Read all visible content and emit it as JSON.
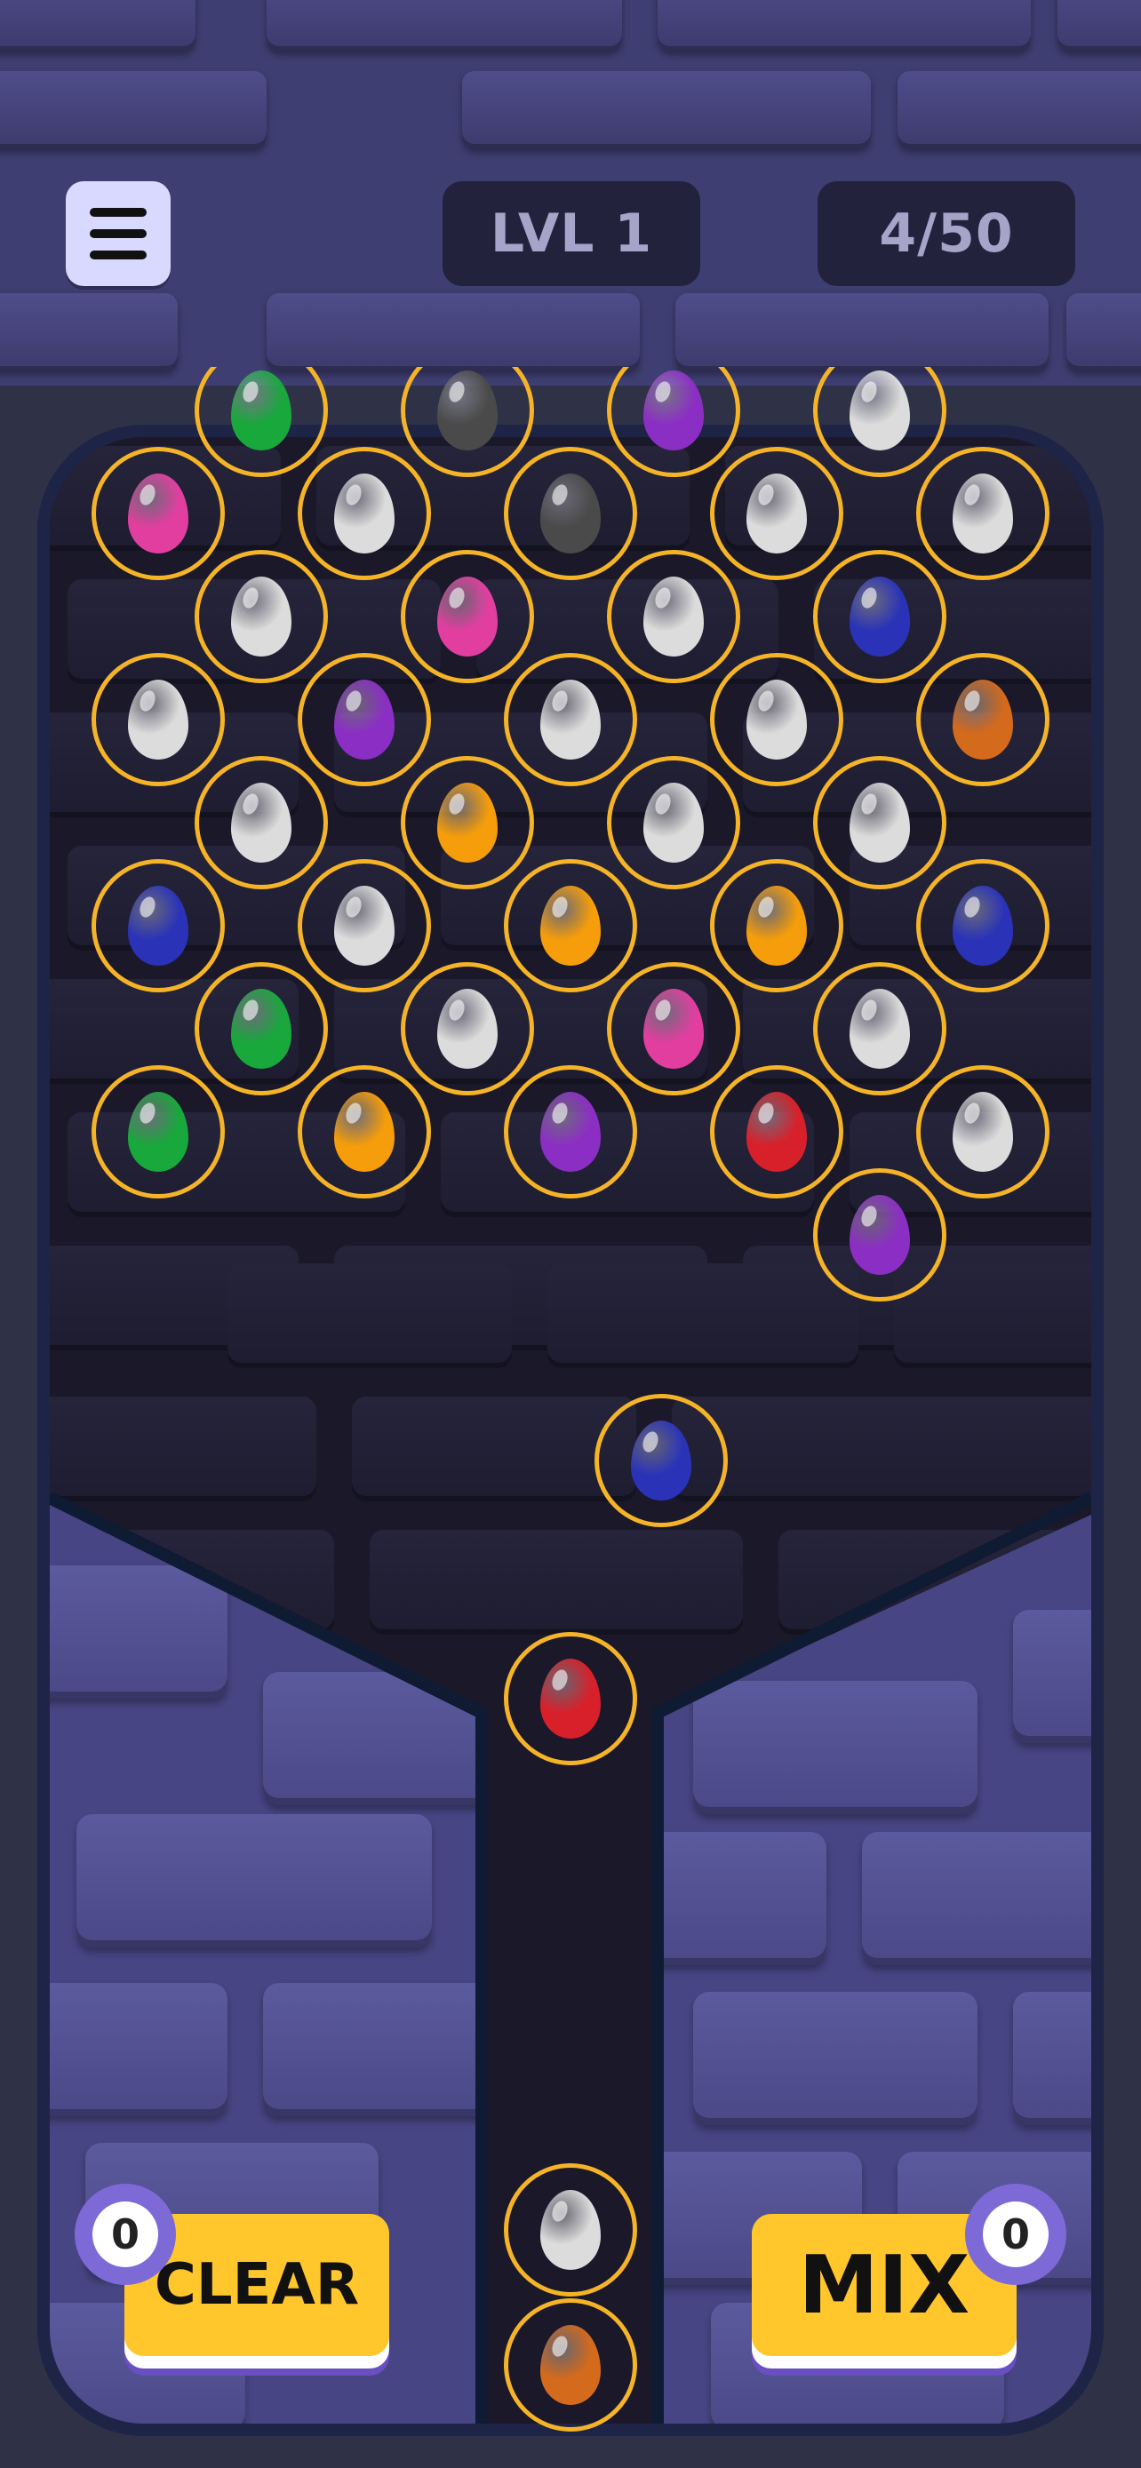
{
  "header": {
    "level_label": "LVL 1",
    "progress_label": "4/50"
  },
  "colors": {
    "pink": "#e23ea0",
    "white": "#dcdcdc",
    "gray": "#4a4a4a",
    "blue": "#2a33b8",
    "purple": "#8b2ec4",
    "orange": "#d46a1c",
    "yellow": "#f59d0a",
    "green": "#18a83c",
    "red": "#d8202a",
    "ring": "#f5b428",
    "button": "#ffc72c"
  },
  "board": {
    "rows": [
      [
        "pink",
        "white",
        "gray",
        "white",
        "white"
      ],
      [
        "white",
        "pink",
        "white",
        "blue"
      ],
      [
        "white",
        "purple",
        "white",
        "white",
        "orange"
      ],
      [
        "white",
        "yellow",
        "white",
        "white"
      ],
      [
        "blue",
        "white",
        "yellow",
        "yellow",
        "blue"
      ],
      [
        "green",
        "white",
        "pink",
        "white"
      ],
      [
        "green",
        "yellow",
        "purple",
        "red",
        "white"
      ],
      [
        "purple"
      ]
    ],
    "top_partial": [
      "green",
      "gray",
      "purple",
      "white"
    ]
  },
  "shooter": {
    "flying": "blue",
    "current": "red",
    "queue": [
      "white",
      "orange"
    ]
  },
  "buttons": {
    "clear_label": "CLEAR",
    "clear_count": "0",
    "mix_label": "MIX",
    "mix_count": "0"
  }
}
